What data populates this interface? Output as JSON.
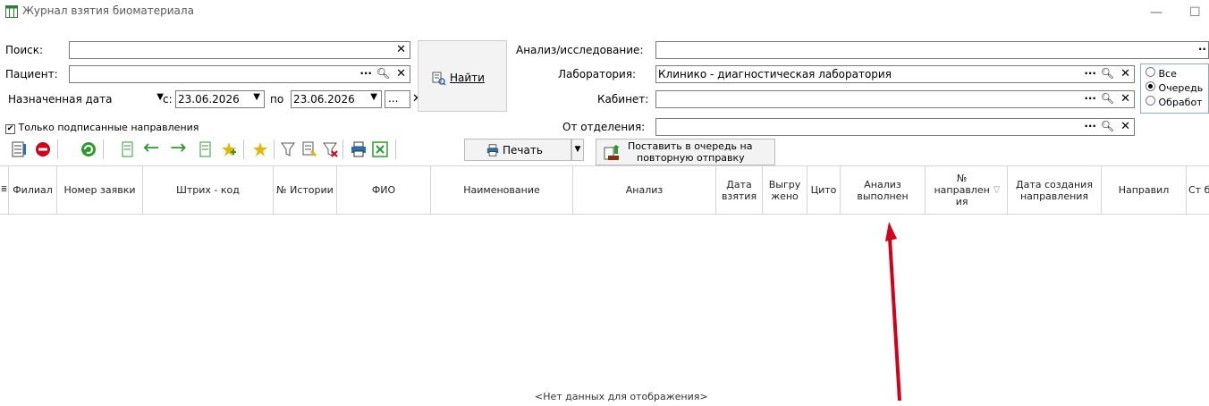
{
  "window": {
    "title": "Журнал взятия биоматериала",
    "minimize": "—",
    "maximize": "☐"
  },
  "search": {
    "label": "Поиск:",
    "value": ""
  },
  "patient": {
    "label": "Пациент:",
    "value": ""
  },
  "date_filter": {
    "type_value": "Назначенная дата",
    "from_label": "с:",
    "from_value": "23.06.2026",
    "to_label": "по",
    "to_value": "23.06.2026",
    "more": "..."
  },
  "find_button": {
    "label": "Найти"
  },
  "signed_only": {
    "label": "Только подписанные направления",
    "checked": true
  },
  "analysis": {
    "label": "Анализ/исследование:",
    "value": ""
  },
  "laboratory": {
    "label": "Лаборатория:",
    "value": "Клинико - диагностическая лаборатория"
  },
  "cabinet": {
    "label": "Кабинет:",
    "value": ""
  },
  "department": {
    "label": "От отделения:",
    "value": ""
  },
  "status_radios": [
    {
      "label": "Все",
      "checked": false
    },
    {
      "label": "Очередь",
      "checked": true
    },
    {
      "label": "Обработ",
      "checked": false
    }
  ],
  "toolbar": {
    "print_label": "Печать",
    "queue_label_line1": "Поставить в очередь на",
    "queue_label_line2": "повторную отправку"
  },
  "grid": {
    "columns": [
      "Филиал",
      "Номер заявки",
      "Штрих - код",
      "№ Истории",
      "ФИО",
      "Наименование",
      "Анализ",
      "Дата взятия",
      "Выгру жено",
      "Цито",
      "Анализ выполнен",
      "№ направлен ия",
      "Дата создания направления",
      "Направил",
      "Ст би"
    ],
    "empty_text": "<Нет данных для отображения>"
  },
  "colors": {
    "accent_red": "#d0021b",
    "icon_green": "#2e9a2e",
    "icon_yellow": "#e8b400"
  }
}
